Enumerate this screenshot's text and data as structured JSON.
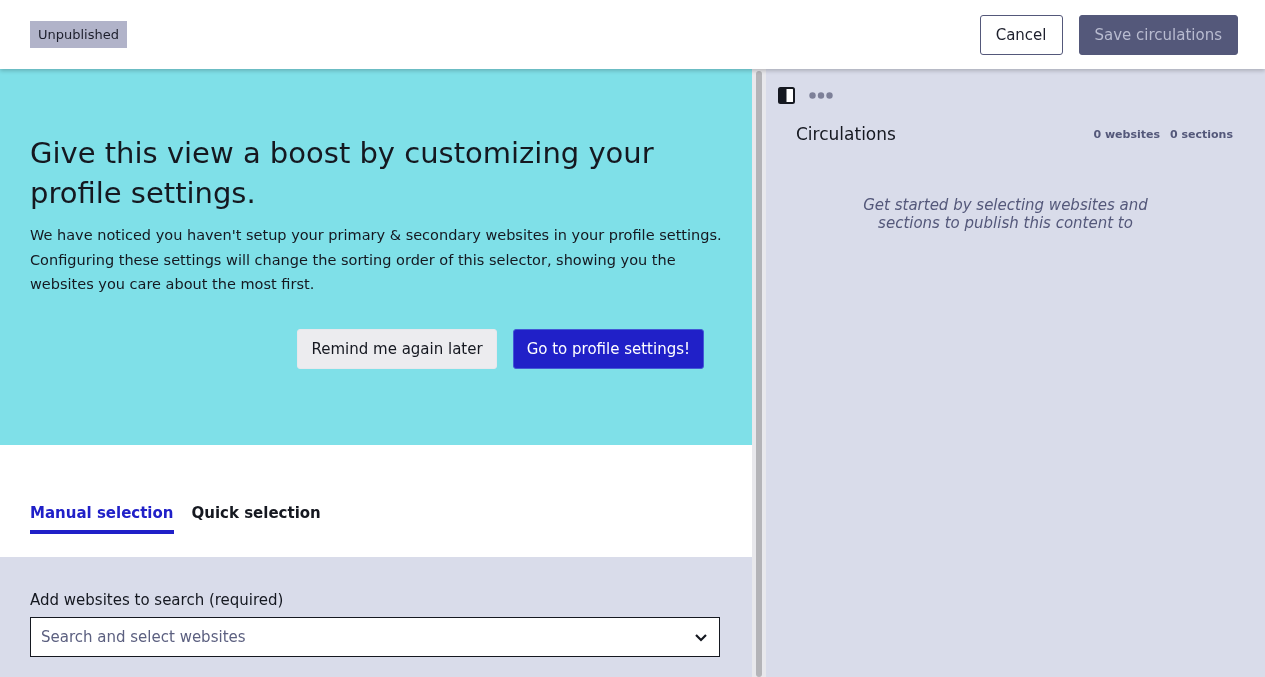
{
  "header": {
    "status_badge": "Unpublished",
    "buttons": [
      {
        "label": "Cancel",
        "kind": "secondary",
        "disabled": false
      },
      {
        "label": "Save circulations",
        "kind": "primary",
        "disabled": true
      }
    ]
  },
  "banner": {
    "title": "Give this view a boost by customizing your profile settings.",
    "text": "We have noticed you haven't setup your primary & secondary websites in your profile settings. Configuring these settings will change the sorting order of this selector, showing you the websites you care about the most first.",
    "buttons": [
      {
        "label": "Remind me again later",
        "kind": "secondary"
      },
      {
        "label": "Go to profile settings!",
        "kind": "primary"
      }
    ]
  },
  "tabs": [
    {
      "label": "Manual selection",
      "selected": true
    },
    {
      "label": "Quick selection",
      "selected": false
    }
  ],
  "website_search": {
    "label": "Add websites to search (required)",
    "placeholder": "Search and select websites"
  },
  "circulations": {
    "title": "Circulations",
    "counts": [
      "0 websites",
      "0 sections"
    ],
    "empty_message": "Get started by selecting websites and sections to publish this content to"
  }
}
